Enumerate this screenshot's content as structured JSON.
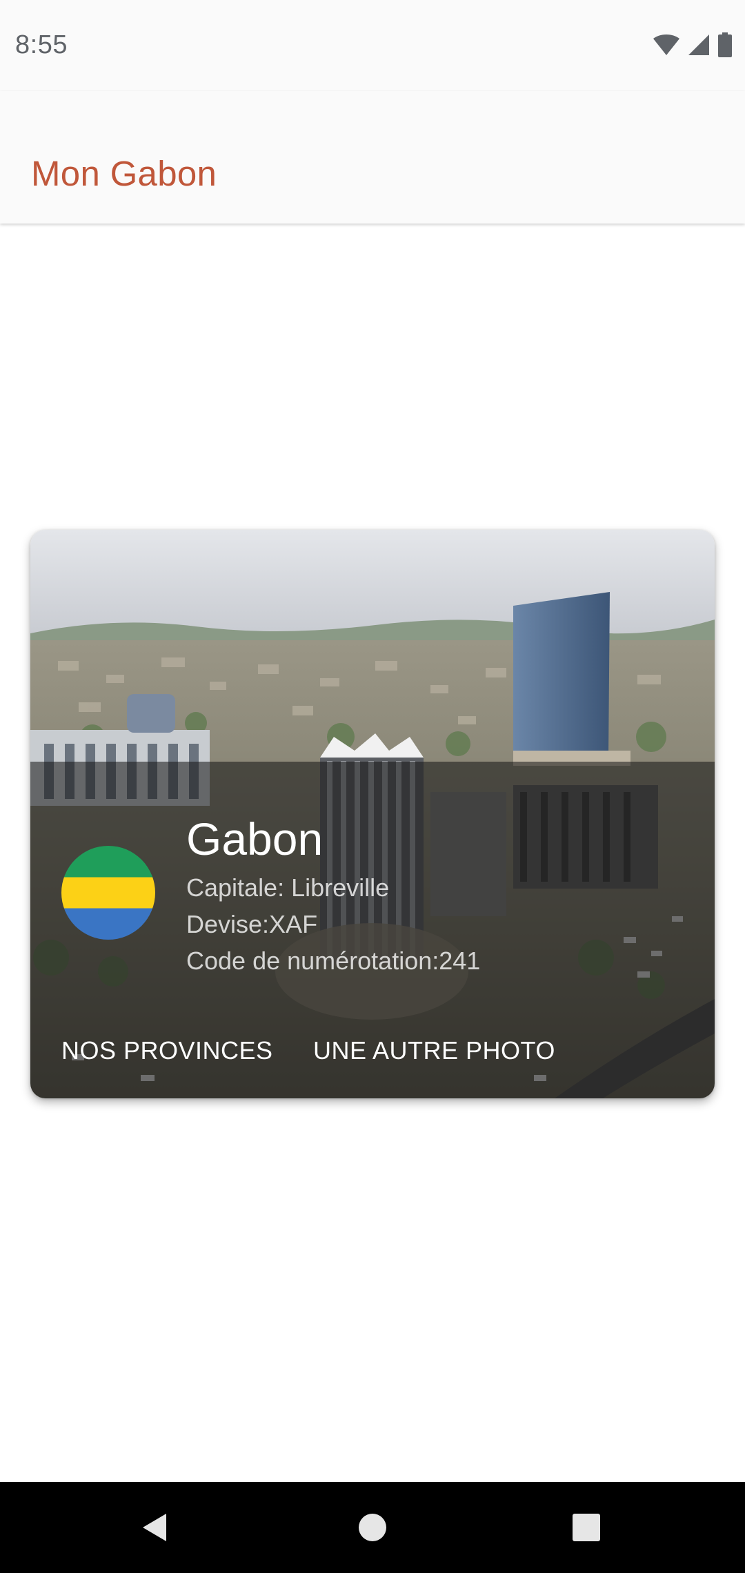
{
  "status_bar": {
    "time": "8:55",
    "icons": [
      "wifi-icon",
      "cell-signal-icon",
      "battery-icon"
    ]
  },
  "app_bar": {
    "title": "Mon Gabon",
    "title_color": "#c0573a"
  },
  "card": {
    "country_name": "Gabon",
    "capital": "Capitale: Libreville",
    "currency": "Devise:XAF",
    "dialing_code": "Code de numérotation:241",
    "flag_colors": [
      "#1f9e5a",
      "#fcd116",
      "#3a75c4"
    ],
    "actions": {
      "provinces": "NOS PROVINCES",
      "other_photo": "UNE AUTRE PHOTO"
    }
  },
  "nav_bar": {
    "buttons": [
      "back-icon",
      "home-icon",
      "recents-icon"
    ]
  }
}
